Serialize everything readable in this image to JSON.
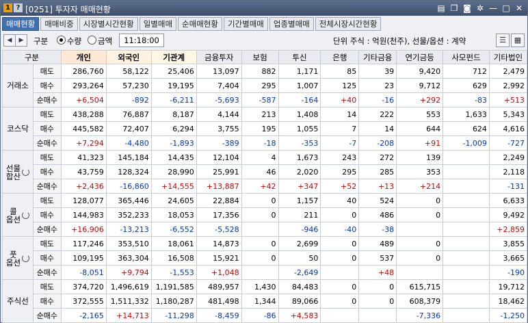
{
  "window": {
    "badge1": "1",
    "badge2": "?",
    "title": "[0251] 투자자 매매현황",
    "icons": [
      "tile-icon",
      "copy-icon",
      "camera-icon",
      "gear-icon",
      "minimize-icon",
      "maximize-icon",
      "close-icon"
    ]
  },
  "tabs": [
    "매매현황",
    "매매비중",
    "시장별시간현황",
    "일별매매",
    "순매매현황",
    "기간별매매",
    "업종별매매",
    "전체시장시간현황"
  ],
  "toolbar": {
    "gubun_label": "구분",
    "radio_qty": "수량",
    "radio_amt": "금액",
    "time": "11:18:00",
    "unit_text": "단위 주식 : 억원(천주), 선물/옵션 : 계약"
  },
  "columns": [
    "구분",
    "개인",
    "외국인",
    "기관계",
    "금융투자",
    "보험",
    "투신",
    "은행",
    "기타금융",
    "연기금등",
    "사모펀드",
    "기타법인"
  ],
  "row_labels": [
    "매도",
    "매수",
    "순매수"
  ],
  "groups": [
    {
      "name": "거래소",
      "rows": [
        [
          "286,760",
          "58,122",
          "25,406",
          "13,097",
          "882",
          "1,171",
          "85",
          "39",
          "9,420",
          "712",
          "2,479"
        ],
        [
          "293,264",
          "57,230",
          "19,195",
          "7,404",
          "295",
          "1,007",
          "125",
          "23",
          "9,712",
          "629",
          "2,992"
        ],
        [
          "+6,504",
          "-892",
          "-6,211",
          "-5,693",
          "-587",
          "-164",
          "+40",
          "-16",
          "+292",
          "-83",
          "+513"
        ]
      ]
    },
    {
      "name": "코스닥",
      "rows": [
        [
          "438,288",
          "76,887",
          "8,187",
          "4,144",
          "213",
          "1,408",
          "14",
          "222",
          "553",
          "1,633",
          "5,343"
        ],
        [
          "445,582",
          "72,407",
          "6,294",
          "3,755",
          "195",
          "1,055",
          "7",
          "14",
          "644",
          "624",
          "4,616"
        ],
        [
          "+7,294",
          "-4,480",
          "-1,893",
          "-389",
          "-18",
          "-353",
          "-7",
          "-208",
          "+91",
          "-1,009",
          "-727"
        ]
      ]
    },
    {
      "name": "선물\n합산",
      "rows": [
        [
          "41,323",
          "145,184",
          "14,435",
          "12,104",
          "4",
          "1,673",
          "243",
          "272",
          "139",
          "",
          "2,249"
        ],
        [
          "43,759",
          "128,324",
          "28,990",
          "25,991",
          "46",
          "2,020",
          "295",
          "285",
          "353",
          "",
          "2,118"
        ],
        [
          "+2,436",
          "-16,860",
          "+14,555",
          "+13,887",
          "+42",
          "+347",
          "+52",
          "+13",
          "+214",
          "",
          "-131"
        ]
      ]
    },
    {
      "name": "콜\n옵션",
      "rows": [
        [
          "128,077",
          "365,446",
          "24,605",
          "22,884",
          "0",
          "1,157",
          "40",
          "524",
          "0",
          "",
          "6,633"
        ],
        [
          "144,983",
          "352,233",
          "18,053",
          "17,356",
          "0",
          "211",
          "0",
          "486",
          "0",
          "",
          "9,492"
        ],
        [
          "+16,906",
          "-13,213",
          "-6,552",
          "-5,528",
          "",
          "-946",
          "-40",
          "-38",
          "",
          "",
          "+2,859"
        ]
      ]
    },
    {
      "name": "풋\n옵션",
      "rows": [
        [
          "117,246",
          "353,510",
          "18,061",
          "14,873",
          "0",
          "2,699",
          "0",
          "489",
          "0",
          "",
          "3,855"
        ],
        [
          "109,195",
          "363,304",
          "16,508",
          "15,921",
          "0",
          "50",
          "0",
          "537",
          "0",
          "",
          "3,665"
        ],
        [
          "-8,051",
          "+9,794",
          "-1,553",
          "+1,048",
          "",
          "-2,649",
          "",
          "+48",
          "",
          "",
          "-190"
        ]
      ]
    },
    {
      "name": "주식선",
      "rows": [
        [
          "374,720",
          "1,496,619",
          "1,191,585",
          "489,957",
          "1,430",
          "84,483",
          "0",
          "0",
          "615,715",
          "",
          "19,712"
        ],
        [
          "372,555",
          "1,511,332",
          "1,180,287",
          "481,498",
          "1,344",
          "89,066",
          "0",
          "0",
          "608,379",
          "",
          "18,462"
        ],
        [
          "-2,165",
          "+14,713",
          "-11,298",
          "-8,459",
          "-86",
          "+4,583",
          "",
          "",
          "-7,336",
          "",
          "-1,250"
        ]
      ]
    }
  ],
  "colors": {
    "positive": "#d40000",
    "negative": "#0033cc",
    "active_tab": "#3f6fb0"
  }
}
